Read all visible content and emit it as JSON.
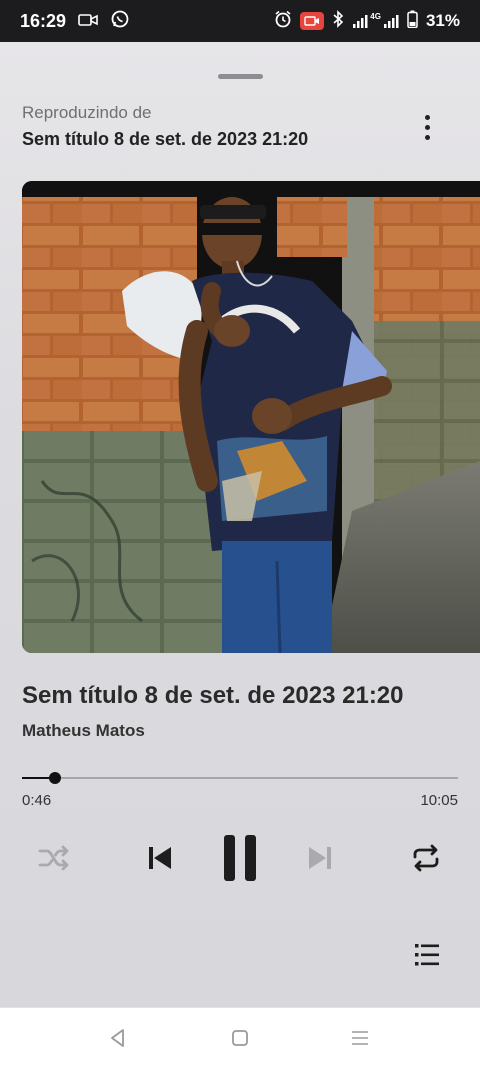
{
  "status_bar": {
    "time": "16:29",
    "network": "4G",
    "battery": "31%",
    "icons": [
      "video-call-icon",
      "whatsapp-icon",
      "alarm-icon",
      "screen-record-icon",
      "bluetooth-icon",
      "signal-icon",
      "battery-icon"
    ]
  },
  "player": {
    "playing_from_label": "Reproduzindo de",
    "playing_from_title": "Sem título 8 de set. de 2023 21:20",
    "track_title": "Sem título 8 de set. de 2023 21:20",
    "artist": "Matheus Matos",
    "elapsed": "0:46",
    "duration": "10:05",
    "progress": 0.076,
    "is_playing": true,
    "shuffle_enabled": false,
    "repeat_enabled": true,
    "next_enabled": false
  },
  "colors": {
    "accent": "#111111",
    "disabled": "#a9a9ae",
    "status_bar_bg": "#1c1c1e",
    "record_badge": "#e8453c"
  },
  "nav_bar": {
    "icons": [
      "back-icon",
      "home-icon",
      "recents-icon"
    ]
  }
}
